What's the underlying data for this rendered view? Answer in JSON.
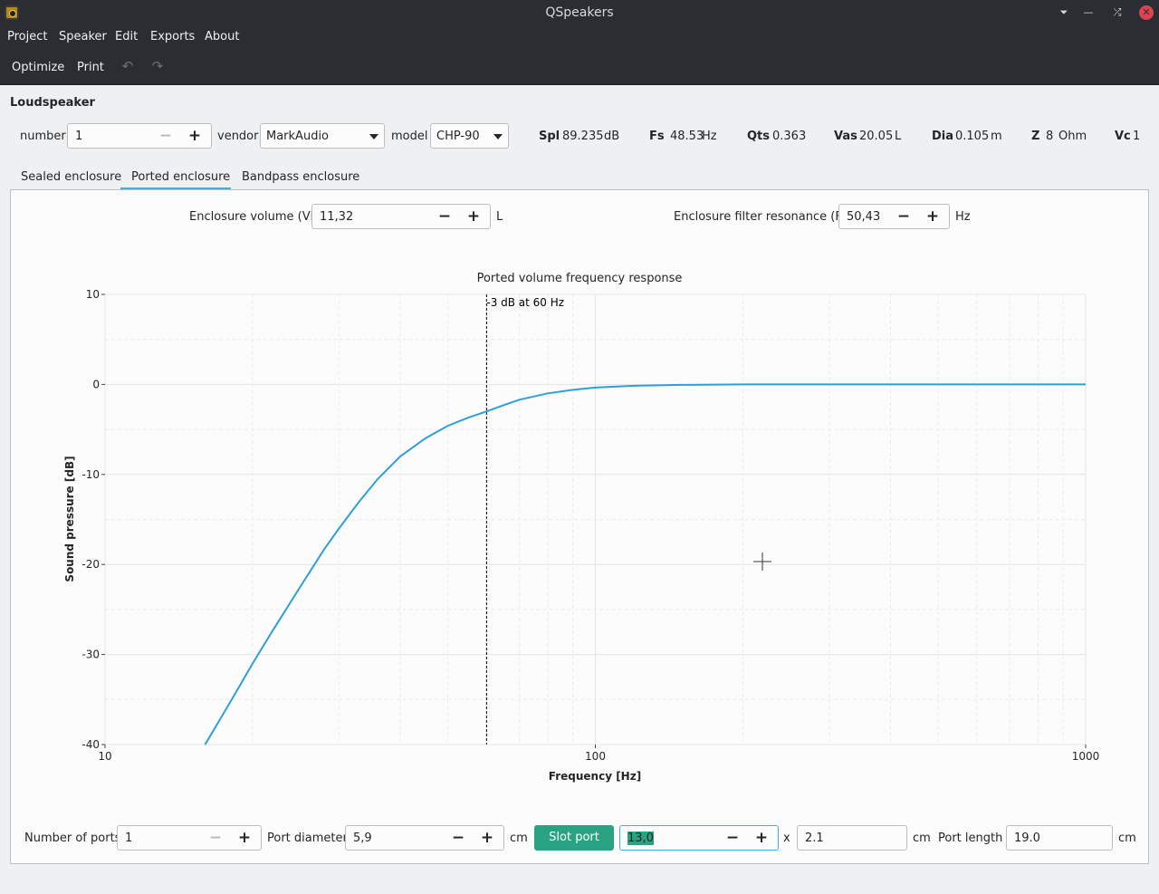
{
  "window": {
    "title": "QSpeakers"
  },
  "menu": [
    "Project",
    "Speaker",
    "Edit",
    "Exports",
    "About"
  ],
  "toolbar": {
    "optimize": "Optimize",
    "print": "Print"
  },
  "loudspeaker": {
    "section_title": "Loudspeaker",
    "number_label": "number",
    "number_value": "1",
    "vendor_label": "vendor",
    "vendor_value": "MarkAudio",
    "model_label": "model",
    "model_value": "CHP-90",
    "params": [
      {
        "name": "Spl",
        "value": "89.235",
        "unit": "dB"
      },
      {
        "name": "Fs",
        "value": "48.53",
        "unit": "Hz"
      },
      {
        "name": "Qts",
        "value": "0.363",
        "unit": ""
      },
      {
        "name": "Vas",
        "value": "20.05",
        "unit": "L"
      },
      {
        "name": "Dia",
        "value": "0.105",
        "unit": "m"
      },
      {
        "name": "Z",
        "value": "8",
        "unit": "Ohm"
      },
      {
        "name": "Vc",
        "value": "1",
        "unit": ""
      }
    ]
  },
  "tabs": [
    "Sealed enclosure",
    "Ported enclosure",
    "Bandpass enclosure"
  ],
  "active_tab": "Ported enclosure",
  "enclosure": {
    "volume_label": "Enclosure volume (Vb)",
    "volume_value": "11,32",
    "volume_unit": "L",
    "resonance_label": "Enclosure filter resonance (Fb)",
    "resonance_value": "50,43",
    "resonance_unit": "Hz"
  },
  "chart_data": {
    "type": "line",
    "title": "Ported volume frequency response",
    "xlabel": "Frequency [Hz]",
    "ylabel": "Sound pressure [dB]",
    "x_scale": "log",
    "xlim": [
      10,
      1000
    ],
    "ylim": [
      -40,
      10
    ],
    "x_ticks": [
      "10",
      "100",
      "1000"
    ],
    "y_ticks": [
      "10",
      "0",
      "-10",
      "-20",
      "-30",
      "-40"
    ],
    "grid": true,
    "color": "#2d9fd9",
    "marker_x": 60,
    "marker_label": "-3 dB at 60 Hz",
    "series": [
      {
        "x": [
          16,
          18,
          20,
          22,
          25,
          28,
          30,
          33,
          36,
          40,
          45,
          50,
          55,
          60,
          65,
          70,
          80,
          90,
          100,
          120,
          150,
          200,
          300,
          500,
          1000
        ],
        "y": [
          -40,
          -35.3,
          -31.0,
          -27.3,
          -22.5,
          -18.3,
          -16.0,
          -13.0,
          -10.5,
          -8.0,
          -6.0,
          -4.6,
          -3.7,
          -3.0,
          -2.3,
          -1.7,
          -1.0,
          -0.6,
          -0.35,
          -0.15,
          -0.05,
          0,
          0,
          0,
          0
        ]
      }
    ]
  },
  "ports": {
    "number_label": "Number of ports",
    "number_value": "1",
    "diameter_label": "Port diameter",
    "diameter_value": "5,9",
    "diameter_unit": "cm",
    "slot_button": "Slot port",
    "slot_width_value": "13,0",
    "times": "x",
    "slot_height_value": "2.1",
    "slot_height_unit": "cm",
    "length_label": "Port length",
    "length_value": "19.0",
    "length_unit": "cm"
  }
}
